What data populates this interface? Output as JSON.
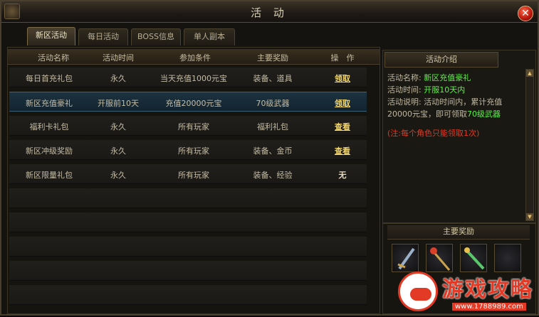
{
  "window": {
    "title": "活 动",
    "close_label": "✕"
  },
  "tabs": [
    {
      "label": "新区活动",
      "active": true
    },
    {
      "label": "每日活动",
      "active": false
    },
    {
      "label": "BOSS信息",
      "active": false
    },
    {
      "label": "单人副本",
      "active": false
    }
  ],
  "table": {
    "headers": [
      "活动名称",
      "活动时间",
      "参加条件",
      "主要奖励",
      "操　作"
    ],
    "rows": [
      {
        "name": "每日首充礼包",
        "time": "永久",
        "condition": "当天充值1000元宝",
        "reward": "装备、道具",
        "action": "领取"
      },
      {
        "name": "新区充值豪礼",
        "time": "开服前10天",
        "condition": "充值20000元宝",
        "reward": "70级武器",
        "action": "领取"
      },
      {
        "name": "福利卡礼包",
        "time": "永久",
        "condition": "所有玩家",
        "reward": "福利礼包",
        "action": "查看"
      },
      {
        "name": "新区冲级奖励",
        "time": "永久",
        "condition": "所有玩家",
        "reward": "装备、金币",
        "action": "查看"
      },
      {
        "name": "新区限量礼包",
        "time": "永久",
        "condition": "所有玩家",
        "reward": "装备、经验",
        "action": "无"
      }
    ]
  },
  "intro": {
    "header": "活动介绍",
    "name_label": "活动名称:",
    "name_value": "新区充值豪礼",
    "time_label": "活动时间:",
    "time_value": "开服10天内",
    "desc_label": "活动说明: 活动时间内，累计充值20000元宝，即可领取",
    "desc_value": "70级武器",
    "note": "(注:每个角色只能领取1次)"
  },
  "rewards": {
    "header": "主要奖励"
  },
  "watermark": {
    "text": "游戏攻略",
    "url": "www.1788989.com"
  },
  "colors": {
    "highlight_green": "#5ef04a",
    "note_red": "#e33a24",
    "action_gold": "#f2d46a"
  }
}
